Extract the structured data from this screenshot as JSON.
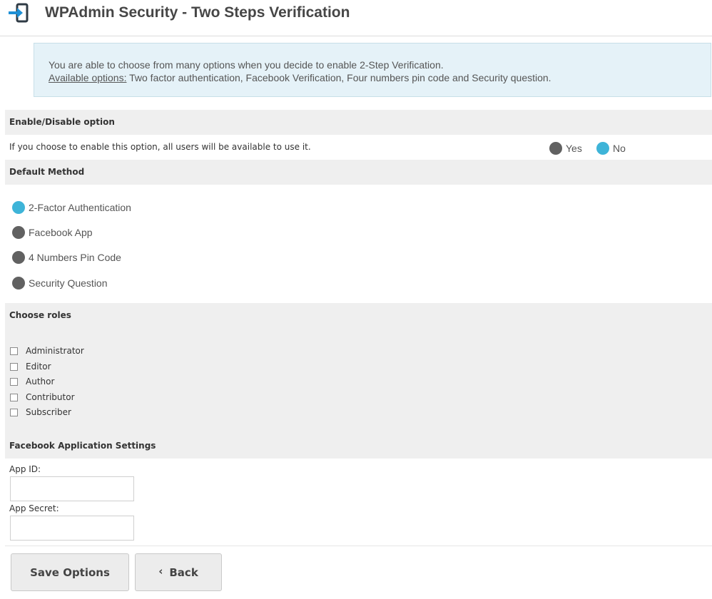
{
  "header": {
    "title": "WPAdmin Security - Two Steps Verification",
    "logo_icon": "login-arrow-icon"
  },
  "notice": {
    "line1": "You are able to choose from many options when you decide to enable 2-Step Verification.",
    "available_label": "Available options:",
    "available_text": " Two factor authentication, Facebook Verification, Four numbers pin code and Security question."
  },
  "enable": {
    "heading": "Enable/Disable option",
    "description": "If you choose to enable this option, all users will be available to use it.",
    "options": [
      {
        "label": "Yes",
        "selected": false
      },
      {
        "label": "No",
        "selected": true
      }
    ]
  },
  "default_method": {
    "heading": "Default Method",
    "options": [
      {
        "label": "2-Factor Authentication",
        "selected": true
      },
      {
        "label": "Facebook App",
        "selected": false
      },
      {
        "label": "4 Numbers Pin Code",
        "selected": false
      },
      {
        "label": "Security Question",
        "selected": false
      }
    ]
  },
  "roles": {
    "heading": "Choose roles",
    "items": [
      {
        "label": "Administrator",
        "checked": false
      },
      {
        "label": "Editor",
        "checked": false
      },
      {
        "label": "Author",
        "checked": false
      },
      {
        "label": "Contributor",
        "checked": false
      },
      {
        "label": "Subscriber",
        "checked": false
      }
    ]
  },
  "facebook": {
    "heading": "Facebook Application Settings",
    "app_id_label": "App ID:",
    "app_id_value": "",
    "app_secret_label": "App Secret:",
    "app_secret_value": ""
  },
  "buttons": {
    "save": "Save Options",
    "back": "Back",
    "back_icon": "chevron-left-icon"
  },
  "colors": {
    "radio_selected": "#3eb4d8",
    "radio_unselected": "#616161",
    "notice_bg": "#e5f2f8",
    "section_bg": "#efefef"
  }
}
